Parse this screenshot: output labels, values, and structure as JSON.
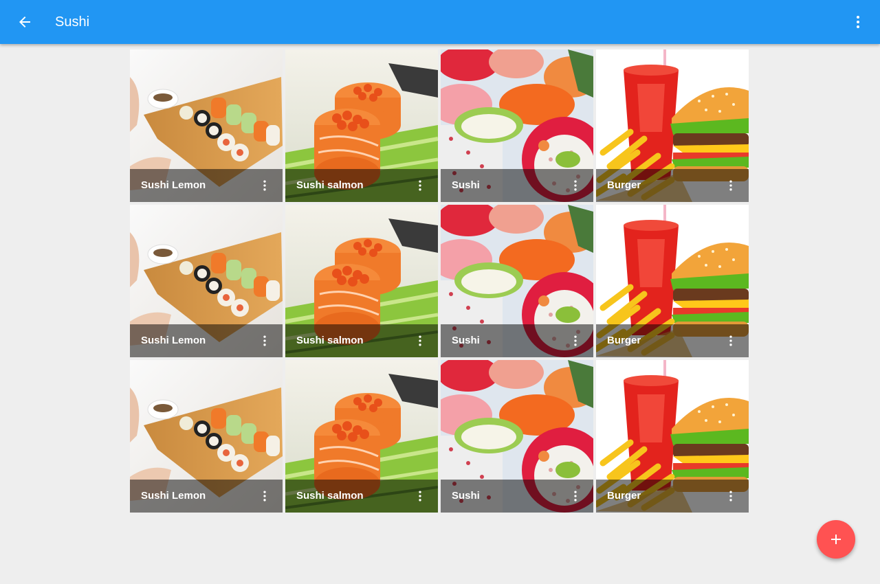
{
  "app_bar": {
    "title": "Sushi",
    "color": "#2196f3",
    "back_icon": "arrow-back-icon",
    "overflow_icon": "more-vert-icon"
  },
  "grid": {
    "columns": 4,
    "rows": [
      {
        "tiles": [
          {
            "label": "Sushi Lemon",
            "image": "sushi-lemon"
          },
          {
            "label": "Sushi salmon",
            "image": "sushi-salmon"
          },
          {
            "label": "Sushi",
            "image": "sushi"
          },
          {
            "label": "Burger",
            "image": "burger"
          }
        ]
      },
      {
        "tiles": [
          {
            "label": "Sushi Lemon",
            "image": "sushi-lemon"
          },
          {
            "label": "Sushi salmon",
            "image": "sushi-salmon"
          },
          {
            "label": "Sushi",
            "image": "sushi"
          },
          {
            "label": "Burger",
            "image": "burger"
          }
        ]
      },
      {
        "tiles": [
          {
            "label": "Sushi Lemon",
            "image": "sushi-lemon"
          },
          {
            "label": "Sushi salmon",
            "image": "sushi-salmon"
          },
          {
            "label": "Sushi",
            "image": "sushi"
          },
          {
            "label": "Burger",
            "image": "burger"
          }
        ]
      }
    ],
    "tile_menu_icon": "more-vert-icon"
  },
  "fab": {
    "icon": "add-icon",
    "color": "#ff5252"
  }
}
